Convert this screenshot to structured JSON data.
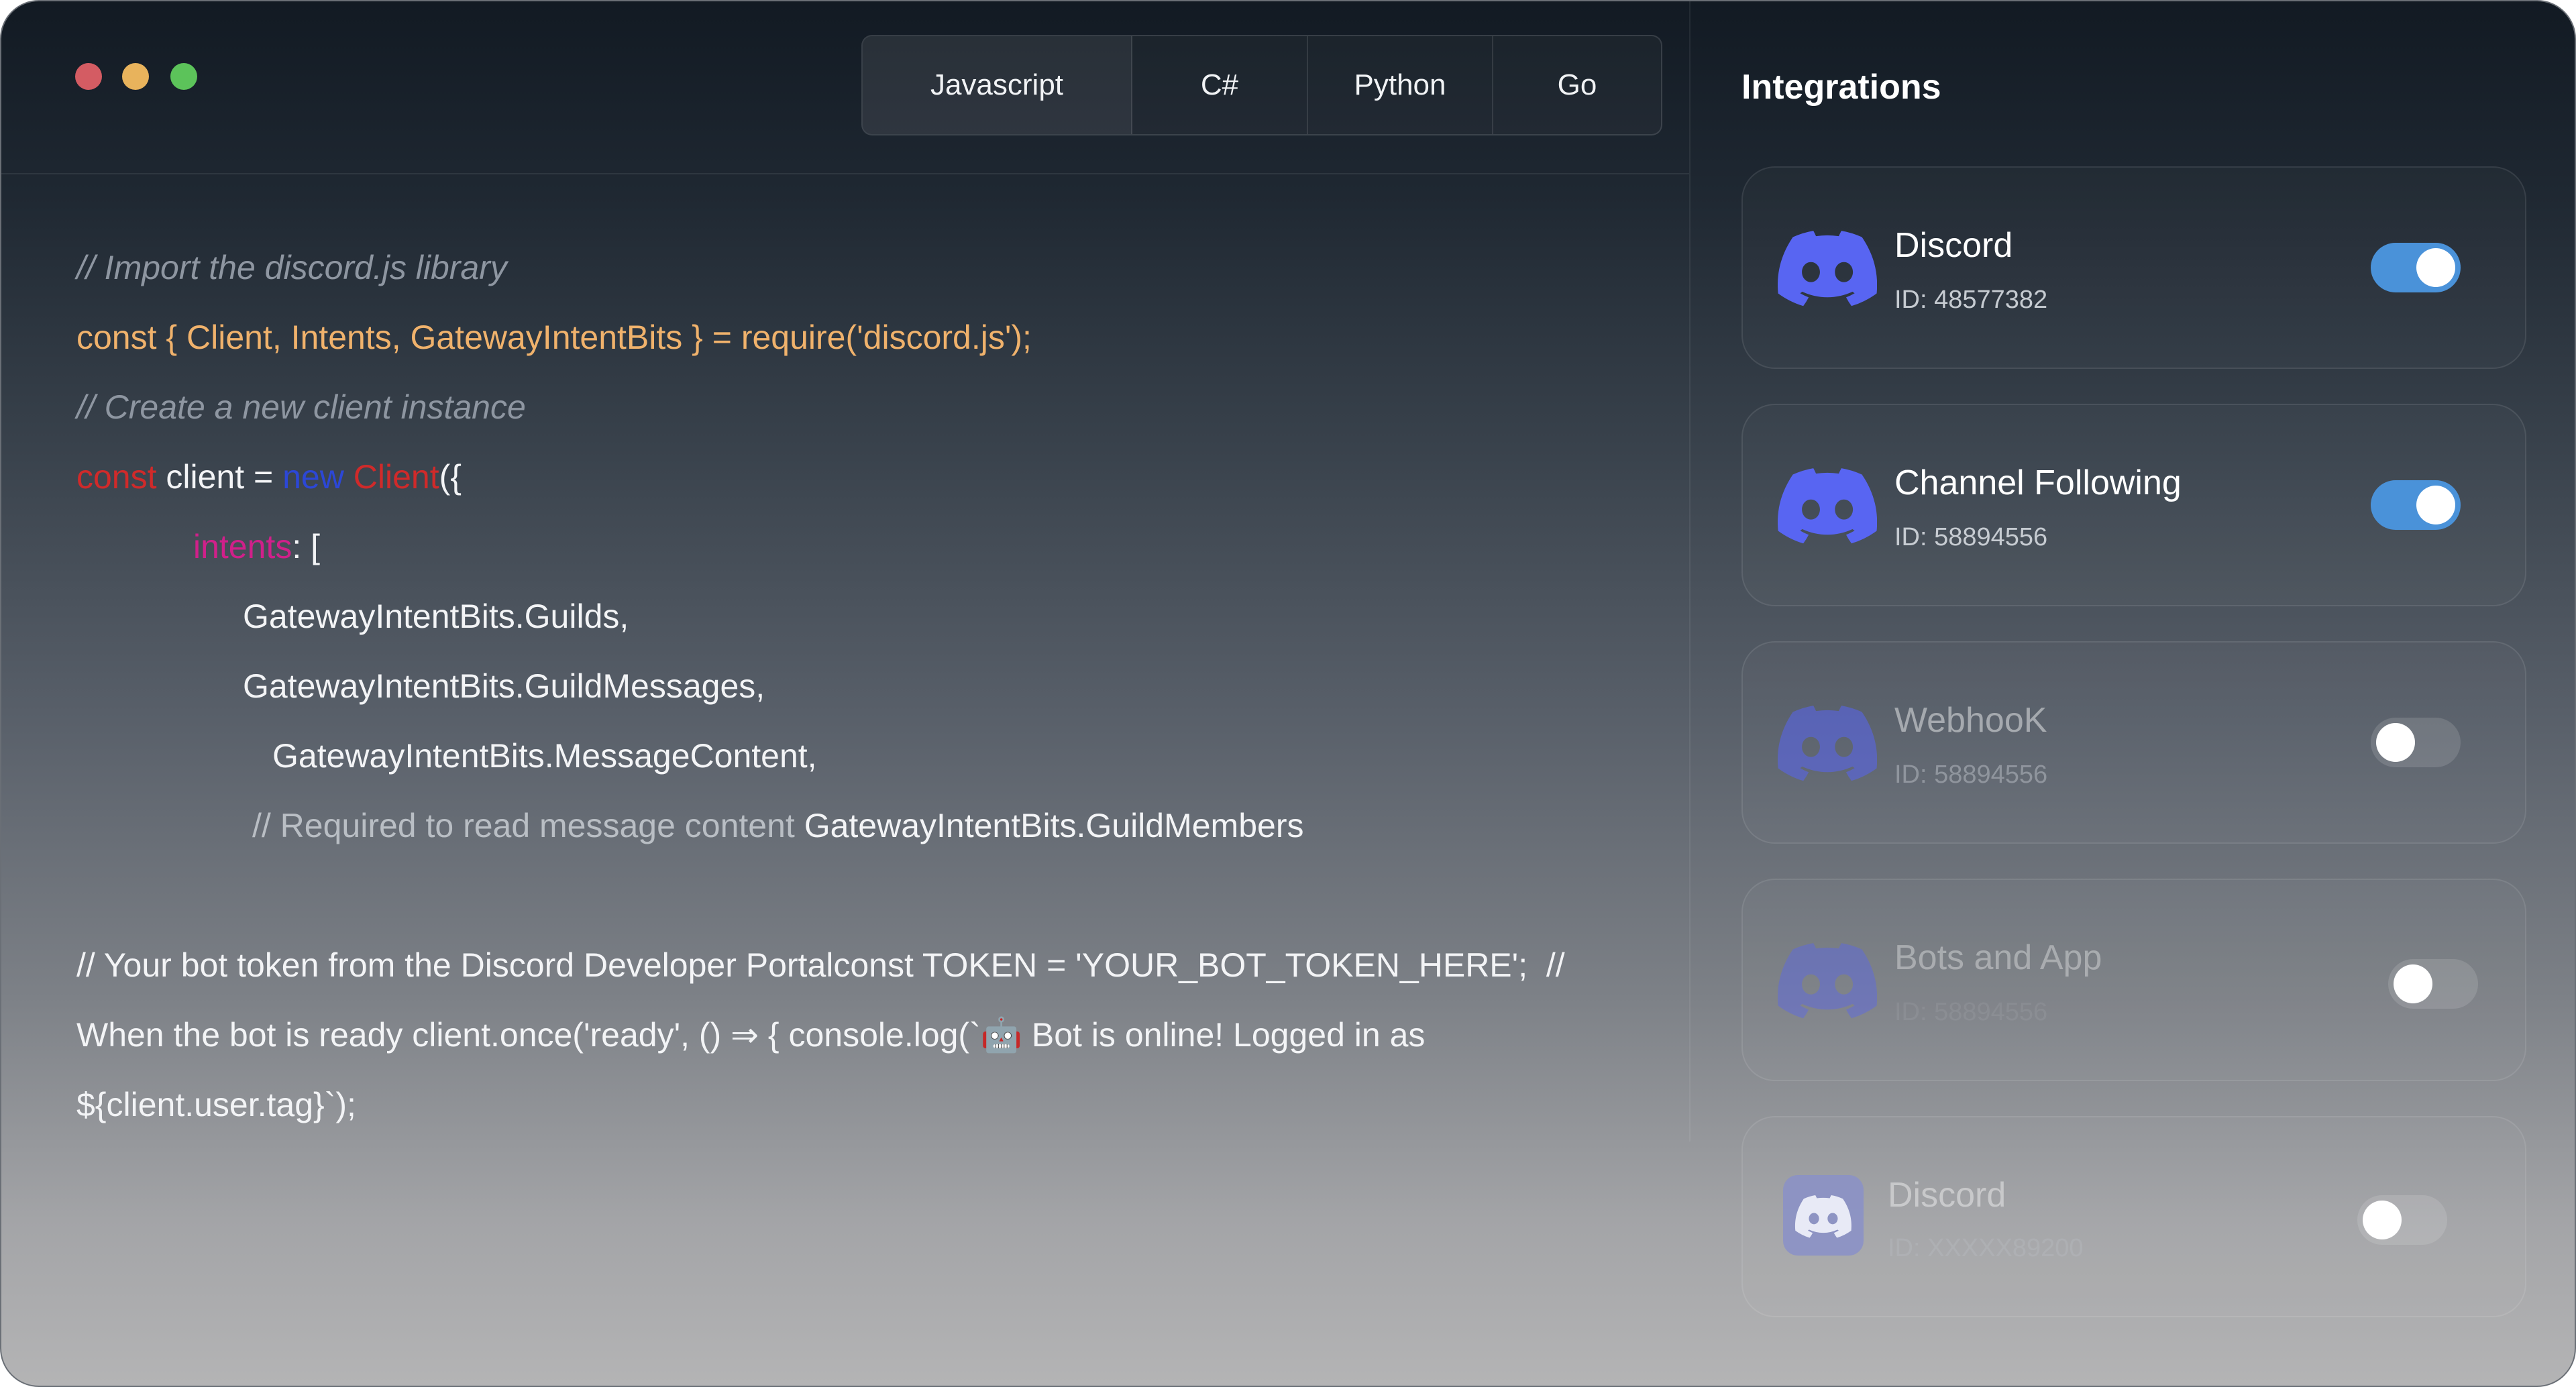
{
  "tabs": [
    {
      "label": "Javascript",
      "active": true
    },
    {
      "label": "C#",
      "active": false
    },
    {
      "label": "Python",
      "active": false
    },
    {
      "label": "Go",
      "active": false
    }
  ],
  "code": {
    "line1": "// Import the discord.js library",
    "line2": "const { Client, Intents, GatewayIntentBits } = require('discord.js');",
    "line3": "// Create a new client instance",
    "line4": {
      "kw": "const",
      "ident": " client = ",
      "new_kw": "new",
      "cls": " Client",
      "rest": "({"
    },
    "line5": {
      "key": "intents",
      "rest": ": ["
    },
    "line6": "GatewayIntentBits.Guilds,",
    "line7": "GatewayIntentBits.GuildMessages,",
    "line8": "GatewayIntentBits.MessageContent,",
    "line9": {
      "comment": "// Required to read message content ",
      "rest": "GatewayIntentBits.GuildMembers"
    },
    "line10": "// Your bot token from the Discord Developer Portalconst TOKEN = 'YOUR_BOT_TOKEN_HERE';  //",
    "line11": "When the bot is ready client.once('ready', () ⇒ { console.log(`🤖 Bot is online! Logged in as",
    "line12": "${client.user.tag}`);"
  },
  "integrations": {
    "title": "Integrations",
    "items": [
      {
        "name": "Discord",
        "id": "ID: 48577382",
        "enabled": true
      },
      {
        "name": "Channel Following",
        "id": "ID: 58894556",
        "enabled": true
      },
      {
        "name": "WebhooK",
        "id": "ID: 58894556",
        "enabled": false
      },
      {
        "name": "Bots and App",
        "id": "ID: 58894556",
        "enabled": false
      },
      {
        "name": "Discord",
        "id": "ID: XXXXX89200",
        "enabled": false
      }
    ]
  },
  "colors": {
    "toggle_on": "#4a92d9",
    "discord_blurple": "#5865F2",
    "code_string": "#f0b26c",
    "code_keyword": "#d02a2a",
    "code_new": "#2c47d6",
    "code_property": "#d0208a"
  }
}
